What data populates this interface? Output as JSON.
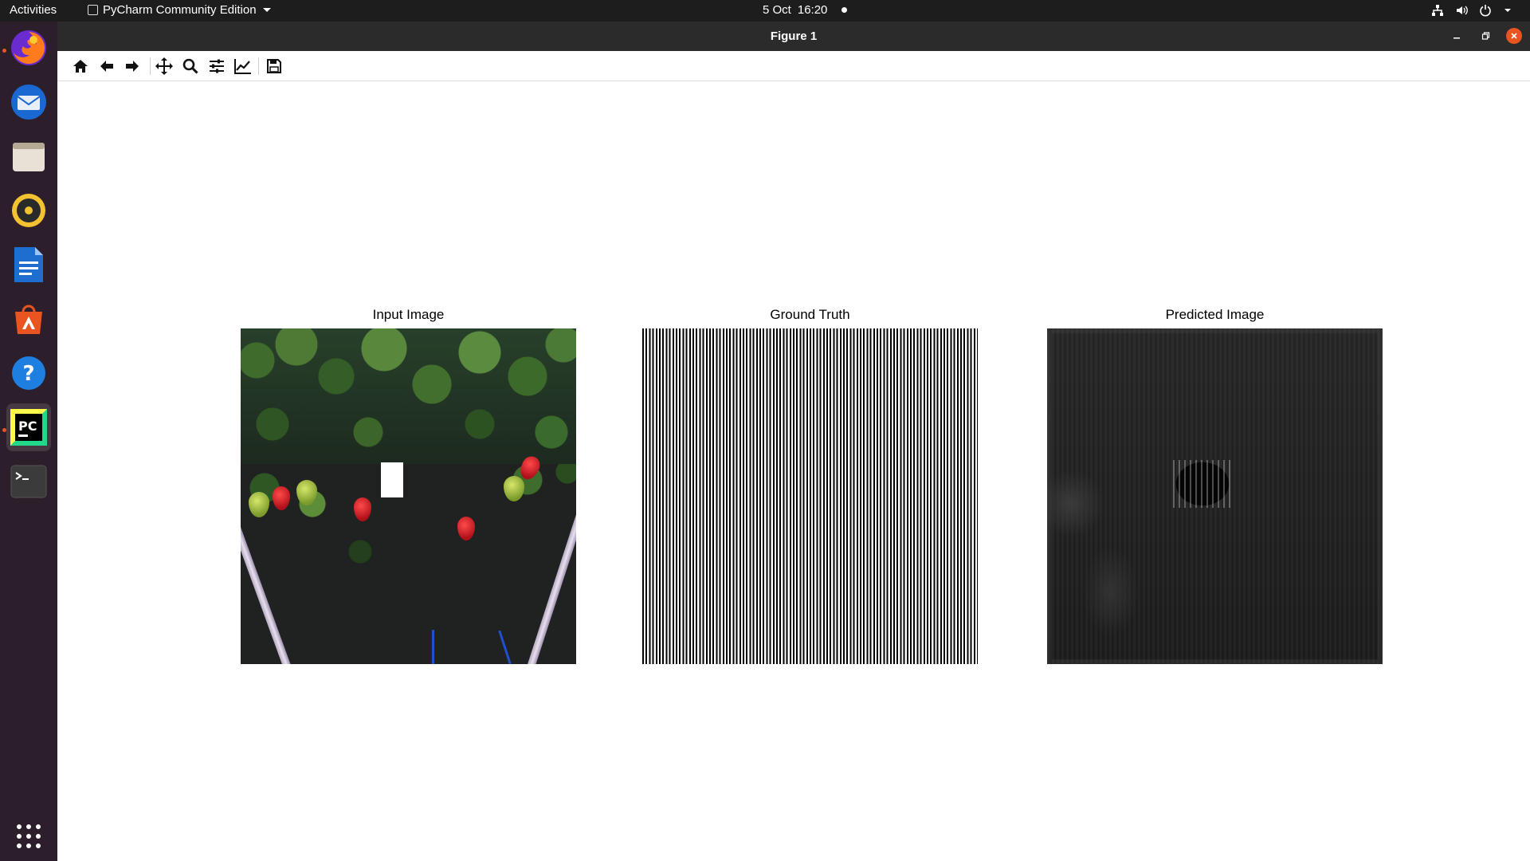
{
  "topbar": {
    "activities": "Activities",
    "app_menu": "PyCharm Community Edition",
    "date": "5 Oct",
    "time": "16:20"
  },
  "dock": {
    "items": [
      "firefox-icon",
      "thunderbird-icon",
      "files-icon",
      "rhythmbox-icon",
      "libreoffice-writer-icon",
      "ubuntu-software-icon",
      "help-icon",
      "pycharm-icon",
      "terminal-icon"
    ],
    "apps_grid": "show-applications-icon"
  },
  "window": {
    "title": "Figure 1"
  },
  "toolbar": {
    "buttons": [
      "home-icon",
      "back-icon",
      "forward-icon",
      "pan-icon",
      "zoom-icon",
      "configure-subplots-icon",
      "edit-axis-icon",
      "save-icon"
    ]
  },
  "figure": {
    "panels": [
      {
        "title": "Input Image"
      },
      {
        "title": "Ground Truth"
      },
      {
        "title": "Predicted Image"
      }
    ]
  },
  "colors": {
    "topbar": "#1d1d1d",
    "dock": "#2c1e2a",
    "accent": "#e95420"
  }
}
